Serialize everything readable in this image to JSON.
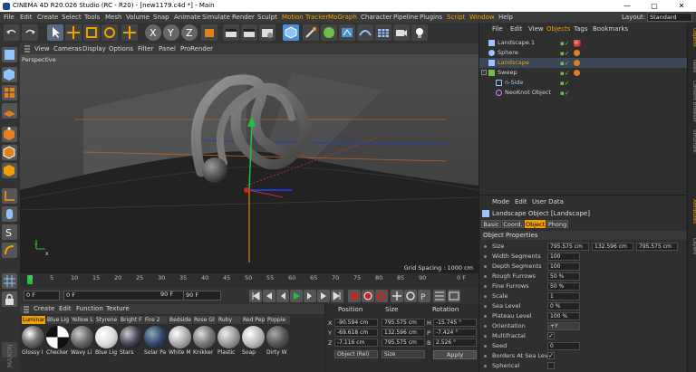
{
  "window": {
    "title": "CINEMA 4D R20.026 Studio (RC - R20) - [new1179.c4d *] - Main",
    "controls": [
      "—",
      "▢",
      "✕"
    ]
  },
  "menubar": {
    "items": [
      "File",
      "Edit",
      "Create",
      "Select",
      "Tools",
      "Mesh",
      "Volume",
      "Snap",
      "Animate",
      "Simulate",
      "Render",
      "Sculpt",
      "Motion Tracker",
      "MoGraph",
      "Character",
      "Pipeline",
      "Plugins",
      "Script",
      "Window",
      "Help"
    ],
    "layout_label": "Layout:",
    "layout_value": "Standard"
  },
  "viewport": {
    "menu": [
      "View",
      "Cameras",
      "Display",
      "Options",
      "Filter",
      "Panel",
      "ProRender"
    ],
    "camera_label": "Perspective",
    "grid_spacing": "Grid Spacing : 1000 cm"
  },
  "timeline": {
    "ticks": [
      "0",
      "5",
      "10",
      "15",
      "20",
      "25",
      "30",
      "35",
      "40",
      "45",
      "50",
      "55",
      "60",
      "65",
      "70",
      "75",
      "80",
      "85",
      "90"
    ],
    "end_label": "0 F",
    "current_frame": "0 F",
    "start_field": "0 F",
    "end_field": "90 F",
    "end_field2": "90 F"
  },
  "materials": {
    "menu": [
      "Create",
      "Edit",
      "Function",
      "Texture"
    ],
    "tabs": [
      "Luminar",
      "Blue Lig",
      "Yellow L",
      "Styrene",
      "Bright F",
      "Fire 2",
      "Bedside",
      "Rose Gl",
      "Ruby",
      "Red Pep",
      "Poppie"
    ],
    "names": [
      "Glossy I",
      "Checker",
      "Wavy Li",
      "Blue Lig",
      "Stars",
      "Solar Pa",
      "White M",
      "Knikker",
      "Plastic",
      "Soap",
      "Dirty W"
    ]
  },
  "coordinates": {
    "headers": [
      "Position",
      "Size",
      "Rotation"
    ],
    "rows": [
      {
        "axis": "X",
        "pos": "-90.594 cm",
        "size": "795.575 cm",
        "rot_axis": "H",
        "rot": "-15.745 °"
      },
      {
        "axis": "Y",
        "pos": "-69.618 cm",
        "size": "132.596 cm",
        "rot_axis": "P",
        "rot": "-7.424 °"
      },
      {
        "axis": "Z",
        "pos": "-7.116 cm",
        "size": "795.575 cm",
        "rot_axis": "B",
        "rot": "2.526 °"
      }
    ],
    "mode": "Object (Rel)",
    "size_mode": "Size",
    "apply_label": "Apply"
  },
  "object_manager": {
    "menu": [
      "File",
      "Edit",
      "View",
      "Objects",
      "Tags",
      "Bookmarks"
    ],
    "highlight_menu": "Objects",
    "objects": [
      {
        "name": "Landscape.1",
        "indent": 0,
        "selected": false,
        "color": "#9ec3ff"
      },
      {
        "name": "Sphere",
        "indent": 0,
        "selected": false,
        "color": "#9ec3ff"
      },
      {
        "name": "Landscape",
        "indent": 0,
        "selected": true,
        "color": "#f0a000"
      },
      {
        "name": "Sweep",
        "indent": 0,
        "selected": false,
        "color": "#cfcfcf"
      },
      {
        "name": "n-Side",
        "indent": 1,
        "selected": false,
        "color": "#9ec3ff"
      },
      {
        "name": "NeoKnot Object",
        "indent": 1,
        "selected": false,
        "color": "#cfcfcf"
      }
    ]
  },
  "side_tabs": [
    "Objects",
    "Takes",
    "Content Browser",
    "Structure",
    "Attributes",
    "Layers"
  ],
  "attributes": {
    "menu": [
      "Mode",
      "Edit",
      "User Data"
    ],
    "title": "Landscape Object [Landscape]",
    "tabs": [
      "Basic",
      "Coord.",
      "Object",
      "Phong"
    ],
    "active_tab": "Object",
    "section": "Object Properties",
    "size": [
      "795.575 cm",
      "132.596 cm",
      "795.575 cm"
    ],
    "properties": [
      {
        "label": "Size",
        "value": ""
      },
      {
        "label": "Width Segments",
        "value": "100"
      },
      {
        "label": "Depth Segments",
        "value": "100"
      },
      {
        "label": "Rough Furrows",
        "value": "50 %"
      },
      {
        "label": "Fine Furrows",
        "value": "50 %"
      },
      {
        "label": "Scale",
        "value": "1"
      },
      {
        "label": "Sea Level",
        "value": "0 %"
      },
      {
        "label": "Plateau Level",
        "value": "100 %"
      },
      {
        "label": "Orientation",
        "value": "+Y"
      },
      {
        "label": "Multifractal",
        "value": "✓"
      },
      {
        "label": "Seed",
        "value": "0"
      },
      {
        "label": "Borders At Sea Level",
        "value": "✓"
      },
      {
        "label": "Spherical",
        "value": ""
      }
    ]
  }
}
